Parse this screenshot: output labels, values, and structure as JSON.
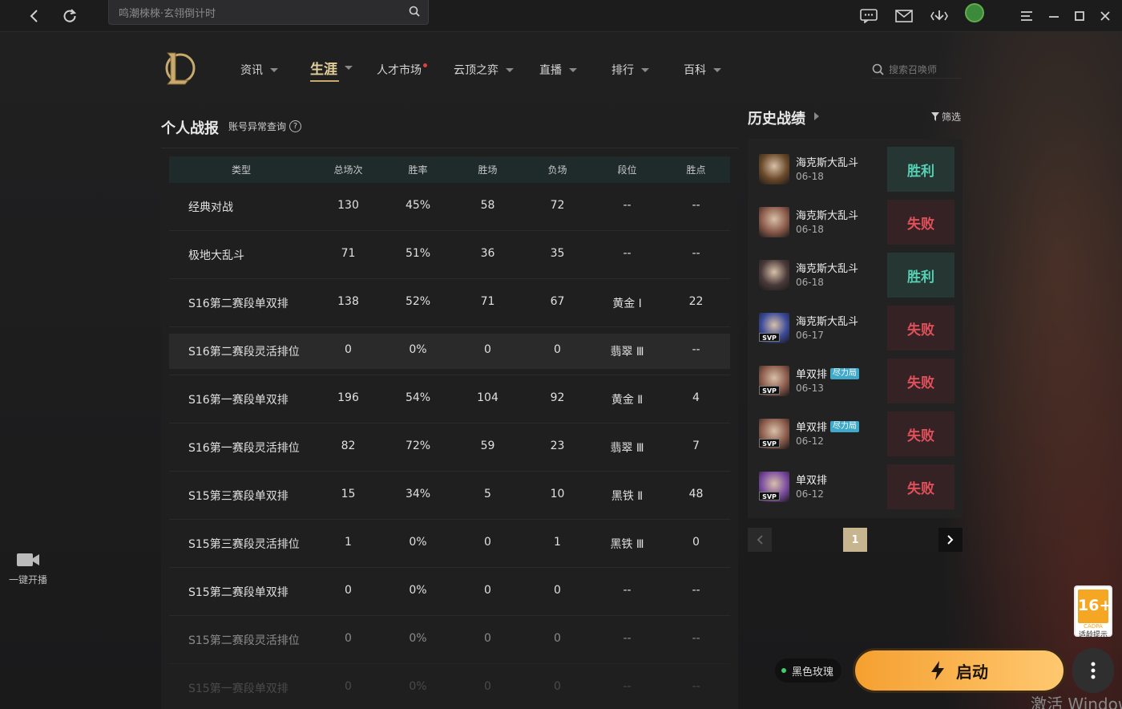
{
  "topbar": {
    "search_placeholder": "鸣潮棶棶·玄翎倒计时"
  },
  "nav": {
    "items": [
      {
        "label": "资讯"
      },
      {
        "label": "生涯"
      },
      {
        "label": "人才市场"
      },
      {
        "label": "云顶之弈"
      },
      {
        "label": "直播"
      },
      {
        "label": "排行"
      },
      {
        "label": "百科"
      }
    ],
    "search_placeholder": "搜索召唤师"
  },
  "report": {
    "title": "个人战报",
    "subtitle": "账号异常查询",
    "qmark": "?",
    "columns": [
      "类型",
      "总场次",
      "胜率",
      "胜场",
      "负场",
      "段位",
      "胜点"
    ],
    "rows": [
      {
        "type": "经典对战",
        "total": "130",
        "winrate": "45%",
        "wins": "58",
        "losses": "72",
        "rank": "--",
        "lp": "--"
      },
      {
        "type": "极地大乱斗",
        "total": "71",
        "winrate": "51%",
        "wins": "36",
        "losses": "35",
        "rank": "--",
        "lp": "--"
      },
      {
        "type": "S16第二赛段单双排",
        "total": "138",
        "winrate": "52%",
        "wins": "71",
        "losses": "67",
        "rank": "黄金 Ⅰ",
        "lp": "22"
      },
      {
        "type": "S16第二赛段灵活排位",
        "total": "0",
        "winrate": "0%",
        "wins": "0",
        "losses": "0",
        "rank": "翡翠 Ⅲ",
        "lp": "--"
      },
      {
        "type": "S16第一赛段单双排",
        "total": "196",
        "winrate": "54%",
        "wins": "104",
        "losses": "92",
        "rank": "黄金 Ⅱ",
        "lp": "4"
      },
      {
        "type": "S16第一赛段灵活排位",
        "total": "82",
        "winrate": "72%",
        "wins": "59",
        "losses": "23",
        "rank": "翡翠 Ⅲ",
        "lp": "7"
      },
      {
        "type": "S15第三赛段单双排",
        "total": "15",
        "winrate": "34%",
        "wins": "5",
        "losses": "10",
        "rank": "黑铁 Ⅱ",
        "lp": "48"
      },
      {
        "type": "S15第三赛段灵活排位",
        "total": "1",
        "winrate": "0%",
        "wins": "0",
        "losses": "1",
        "rank": "黑铁 Ⅲ",
        "lp": "0"
      },
      {
        "type": "S15第二赛段单双排",
        "total": "0",
        "winrate": "0%",
        "wins": "0",
        "losses": "0",
        "rank": "--",
        "lp": "--"
      },
      {
        "type": "S15第二赛段灵活排位",
        "total": "0",
        "winrate": "0%",
        "wins": "0",
        "losses": "0",
        "rank": "--",
        "lp": "--"
      },
      {
        "type": "S15第一赛段单双排",
        "total": "0",
        "winrate": "0%",
        "wins": "0",
        "losses": "0",
        "rank": "--",
        "lp": "--"
      }
    ]
  },
  "history": {
    "title": "历史战绩",
    "filter_label": "筛选",
    "matches": [
      {
        "mode": "海克斯大乱斗",
        "badge": "",
        "date": "06-18",
        "result": "胜利",
        "outcome": "win",
        "svp": "",
        "champ_color": "#6b4a2a"
      },
      {
        "mode": "海克斯大乱斗",
        "badge": "",
        "date": "06-18",
        "result": "失败",
        "outcome": "loss",
        "svp": "",
        "champ_color": "#8a5a4a"
      },
      {
        "mode": "海克斯大乱斗",
        "badge": "",
        "date": "06-18",
        "result": "胜利",
        "outcome": "win",
        "svp": "",
        "champ_color": "#4a3a3a"
      },
      {
        "mode": "海克斯大乱斗",
        "badge": "",
        "date": "06-17",
        "result": "失败",
        "outcome": "loss",
        "svp": "SVP",
        "champ_color": "#3a4a9a"
      },
      {
        "mode": "单双排",
        "badge": "尽力局",
        "date": "06-13",
        "result": "失败",
        "outcome": "loss",
        "svp": "SVP",
        "champ_color": "#8a5a4a"
      },
      {
        "mode": "单双排",
        "badge": "尽力局",
        "date": "06-12",
        "result": "失败",
        "outcome": "loss",
        "svp": "SVP",
        "champ_color": "#8a5a4a"
      },
      {
        "mode": "单双排",
        "badge": "",
        "date": "06-12",
        "result": "失败",
        "outcome": "loss",
        "svp": "SVP",
        "champ_color": "#7a4aa0"
      }
    ],
    "page": "1"
  },
  "side": {
    "stream_label": "一键开播"
  },
  "age_badge": {
    "rating": "16+",
    "org": "CADPA",
    "label": "适龄提示"
  },
  "bottom": {
    "status_label": "黑色玫瑰",
    "launch_label": "启动"
  },
  "watermark": "激活 Window"
}
